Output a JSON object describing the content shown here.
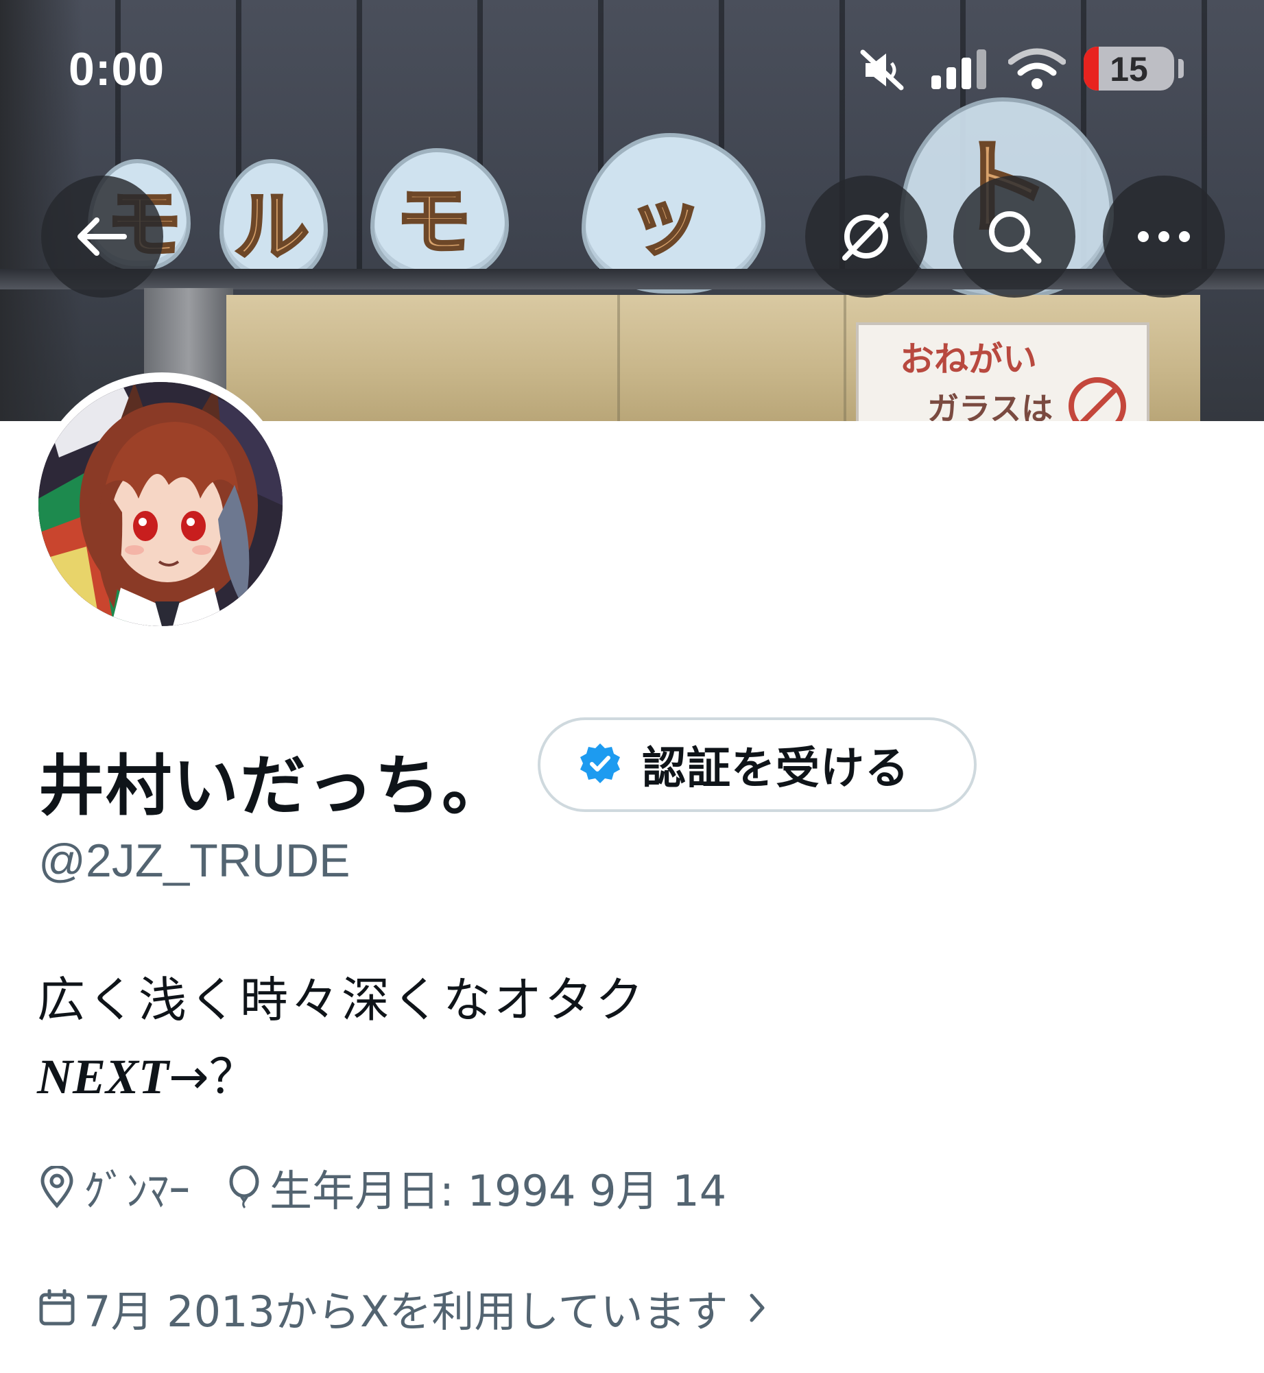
{
  "status_bar": {
    "time": "0:00",
    "battery_level": "15",
    "icons": [
      "mute-icon",
      "cellular-signal-icon",
      "wifi-icon",
      "battery-icon"
    ]
  },
  "banner": {
    "sign_letters": [
      "モ",
      "ル",
      "モ",
      "ッ",
      "ト"
    ],
    "notice_line1": "おねがい",
    "notice_line2": "ガラスは"
  },
  "nav": {
    "back_icon": "back-arrow-icon",
    "grok_icon": "grok-icon",
    "search_icon": "search-icon",
    "more_icon": "more-icon"
  },
  "profile": {
    "display_name": "井村いだっち。",
    "verify_button_label": "認証を受ける",
    "handle": "@2JZ_TRUDE",
    "bio_line1": "広く浅く時々深くなオタク",
    "bio_next": "NEXT",
    "bio_next_suffix": "→？",
    "location": "ｸﾞﾝﾏｰ",
    "birthday": "生年月日: 1994 9月 14",
    "joined": "7月 2013からXを利用しています"
  },
  "colors": {
    "primary_text": "#0f1419",
    "secondary_text": "#536471",
    "verified_blue": "#1d9bf0",
    "battery_low_red": "#e8231f",
    "button_border": "#cfd9de"
  }
}
